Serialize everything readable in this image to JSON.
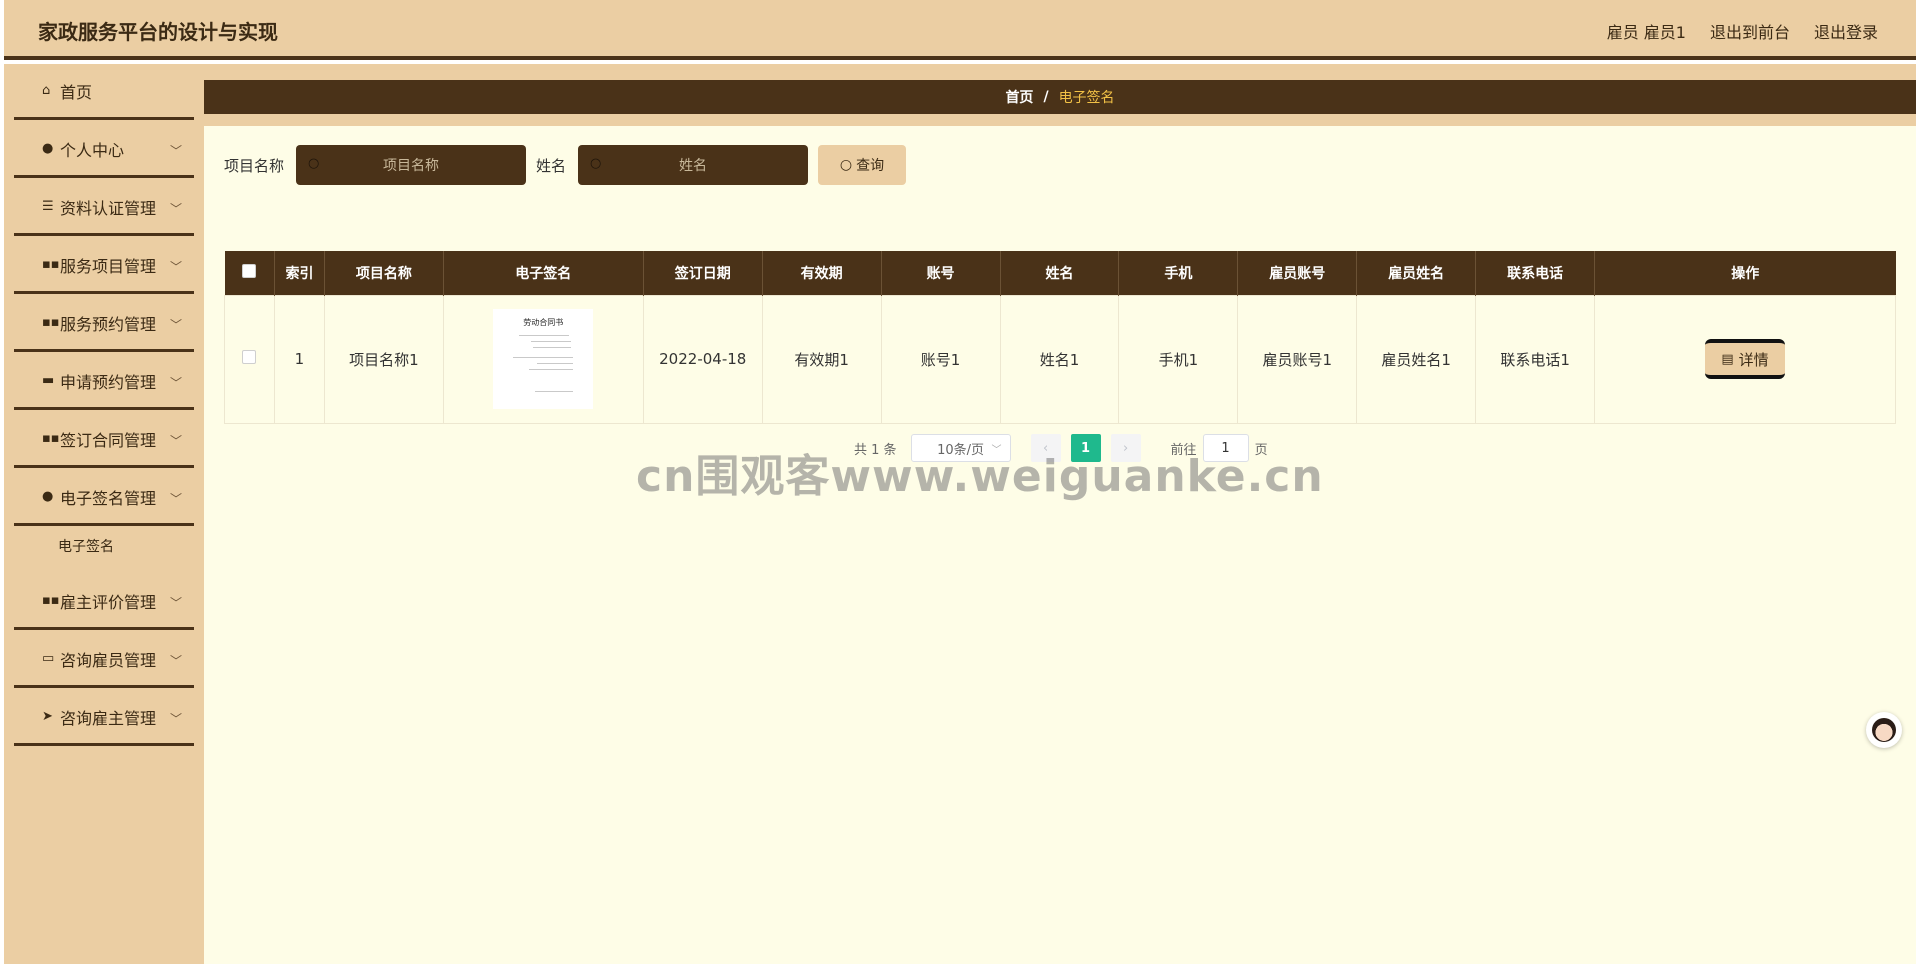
{
  "header": {
    "title": "家政服务平台的设计与实现",
    "user": "雇员 雇员1",
    "to_front": "退出到前台",
    "logout": "退出登录"
  },
  "sidebar": {
    "items": [
      {
        "label": "首页",
        "icon": "home-icon"
      },
      {
        "label": "个人中心",
        "icon": "user-icon"
      },
      {
        "label": "资料认证管理",
        "icon": "list-icon"
      },
      {
        "label": "服务项目管理",
        "icon": "grid-icon"
      },
      {
        "label": "服务预约管理",
        "icon": "grid-icon"
      },
      {
        "label": "申请预约管理",
        "icon": "message-icon"
      },
      {
        "label": "签订合同管理",
        "icon": "grid-icon"
      },
      {
        "label": "电子签名管理",
        "icon": "user-icon"
      },
      {
        "label": "雇主评价管理",
        "icon": "grid-icon"
      },
      {
        "label": "咨询雇员管理",
        "icon": "monitor-icon"
      },
      {
        "label": "咨询雇主管理",
        "icon": "send-icon"
      }
    ],
    "sub_item": "电子签名"
  },
  "breadcrumb": {
    "home": "首页",
    "separator": "/",
    "current": "电子签名"
  },
  "search": {
    "project_label": "项目名称",
    "project_placeholder": "项目名称",
    "name_label": "姓名",
    "name_placeholder": "姓名",
    "button": "查询"
  },
  "table": {
    "headers": [
      "索引",
      "项目名称",
      "电子签名",
      "签订日期",
      "有效期",
      "账号",
      "姓名",
      "手机",
      "雇员账号",
      "雇员姓名",
      "联系电话",
      "操作"
    ],
    "rows": [
      {
        "index": "1",
        "project": "项目名称1",
        "signature_doc_title": "劳动合同书",
        "date": "2022-04-18",
        "validity": "有效期1",
        "account": "账号1",
        "name": "姓名1",
        "phone": "手机1",
        "employee_account": "雇员账号1",
        "employee_name": "雇员姓名1",
        "contact": "联系电话1",
        "action": "详情"
      }
    ]
  },
  "pagination": {
    "total": "共 1 条",
    "page_size": "10条/页",
    "current_page": "1",
    "goto_label": "前往",
    "goto_value": "1",
    "page_unit": "页"
  },
  "watermark": "cn围观客www.weiguanke.cn",
  "colors": {
    "header_bg": "#ebcea3",
    "dark_brown": "#4a3218",
    "main_bg": "#fefde7",
    "active_page": "#1fb98d",
    "crumb_current": "#f2c146"
  }
}
